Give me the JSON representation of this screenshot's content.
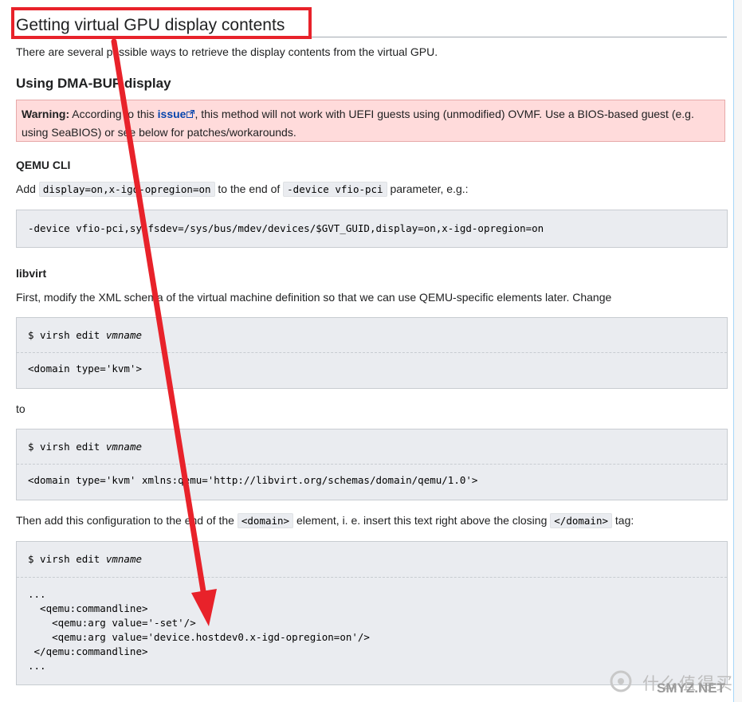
{
  "section": {
    "title": "Getting virtual GPU display contents",
    "intro": "There are several possible ways to retrieve the display contents from the virtual GPU."
  },
  "dmabuf": {
    "heading": "Using DMA-BUF display",
    "warning": {
      "label": "Warning:",
      "text_before": " According to this ",
      "link": "issue",
      "text_after": ", this method will not work with UEFI guests using (unmodified) OVMF. Use a BIOS-based guest (e.g.",
      "line2": "using SeaBIOS) or see below for patches/workarounds."
    }
  },
  "qemu_cli": {
    "heading": "QEMU CLI",
    "add": "Add",
    "code1": "display=on,x-igd-opregion=on",
    "mid": "to the end of",
    "code2": "-device vfio-pci",
    "end": "parameter, e.g.:",
    "example": "-device vfio-pci,sysfsdev=/sys/bus/mdev/devices/$GVT_GUID,display=on,x-igd-opregion=on"
  },
  "libvirt": {
    "heading": "libvirt",
    "para1": "First, modify the XML schema of the virtual machine definition so that we can use QEMU-specific elements later. Change",
    "cmd_prompt": "$ virsh edit ",
    "cmd_arg": "vmname",
    "block1_line": "<domain type='kvm'>",
    "to": "to",
    "block2_line": "<domain type='kvm' xmlns:qemu='http://libvirt.org/schemas/domain/qemu/1.0'>",
    "para2_before": "Then add this configuration to the end of the",
    "para2_code1": "<domain>",
    "para2_mid": "element, i. e. insert this text right above the closing",
    "para2_code2": "</domain>",
    "para2_end": "tag:",
    "block3_lines": [
      "...",
      "  <qemu:commandline>",
      "    <qemu:arg value='-set'/>",
      "    <qemu:arg value='device.hostdev0.x-igd-opregion=on'/>",
      " </qemu:commandline>",
      "..."
    ]
  },
  "watermark": {
    "cn": "什么值得买",
    "en": "SMYZ.NET"
  },
  "colors": {
    "annotation_red": "#e8222a",
    "link_blue": "#0645ad",
    "warning_bg": "#ffdbdb"
  }
}
